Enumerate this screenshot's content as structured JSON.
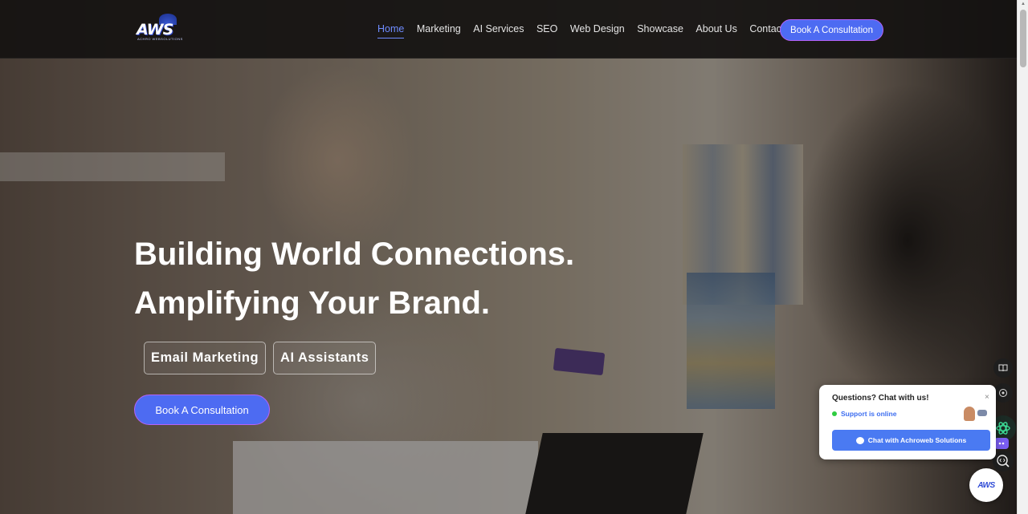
{
  "brand": {
    "logo_mark": "AWS",
    "logo_sub": "ACHRO WEBSOLUTIONS"
  },
  "nav": {
    "items": [
      {
        "label": "Home",
        "active": true
      },
      {
        "label": "Marketing",
        "active": false
      },
      {
        "label": "AI Services",
        "active": false
      },
      {
        "label": "SEO",
        "active": false
      },
      {
        "label": "Web Design",
        "active": false
      },
      {
        "label": "Showcase",
        "active": false
      },
      {
        "label": "About Us",
        "active": false
      },
      {
        "label": "Contact",
        "active": false
      }
    ],
    "cta": "Book A Consultation"
  },
  "hero": {
    "headline_line1": "Building World Connections.",
    "headline_line2": "Amplifying Your Brand.",
    "pills": [
      "Email Marketing",
      "AI Assistants"
    ],
    "cta": "Book A Consultation"
  },
  "chat": {
    "question": "Questions? Chat with us!",
    "close": "×",
    "status": "Support is online",
    "button_label": "Chat with Achroweb Solutions"
  },
  "dock": {
    "icons": [
      "book-icon",
      "headphones-icon",
      "ai-assistant-icon",
      "robot-icon",
      "zoom-icon"
    ]
  },
  "floating_logo": "AWS",
  "colors": {
    "accent": "#4d6bf2",
    "cta_border": "#b562f7",
    "active_nav": "#6f8cff",
    "online": "#2ecc40"
  }
}
